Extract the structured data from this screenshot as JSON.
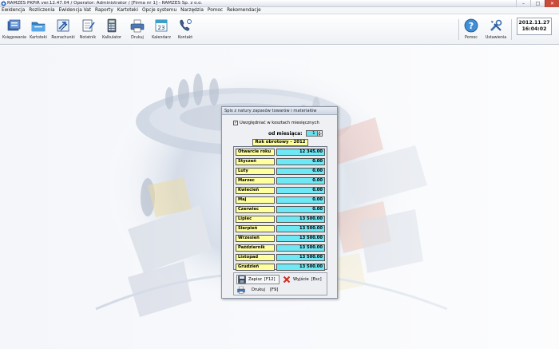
{
  "window": {
    "title": "RAMZES PKPiR  ver.12.47.04 /  Operator: Administrator /  [Firma nr 1] - RAMZES Sp. z o.o."
  },
  "menu": [
    "Ewidencja",
    "Rozliczenia",
    "Ewidencja Vat",
    "Raporty",
    "Kartoteki",
    "Opcje systemu",
    "Narzędzia",
    "Pomoc",
    "Rekomendacje"
  ],
  "toolbar": {
    "buttons": [
      {
        "label": "Księgowanie",
        "icon": "ledger-icon"
      },
      {
        "label": "Kartoteki",
        "icon": "folders-icon"
      },
      {
        "label": "Rozrachunki",
        "icon": "transfer-arrows-icon"
      },
      {
        "label": "Notatnik",
        "icon": "notepad-icon"
      },
      {
        "label": "Kalkulator",
        "icon": "calculator-icon"
      },
      {
        "label": "Drukuj",
        "icon": "printer-icon"
      },
      {
        "label": "Kalendarz",
        "icon": "calendar-icon"
      },
      {
        "label": "Kontakt",
        "icon": "phone-icon"
      }
    ],
    "right_buttons": [
      {
        "label": "Pomoc",
        "icon": "help-icon"
      },
      {
        "label": "Ustawienia",
        "icon": "settings-tools-icon"
      }
    ],
    "calendar_day": "23"
  },
  "datetime": {
    "date": "2012.11.27",
    "time": "16:04:02"
  },
  "dialog": {
    "title": "Spis z natury zapasów towarów i materiałów",
    "checkbox_label": "Uwzględniać w kosztach miesięcznych",
    "checkbox_checked": true,
    "month_label": "od miesiąca:",
    "month_value": "1",
    "year_header": "Rok obrotowy - 2012",
    "rows": [
      {
        "label": "Otwarcie roku",
        "value": "12 345.00"
      },
      {
        "label": "Styczeń",
        "value": "0.00"
      },
      {
        "label": "Luty",
        "value": "0.00"
      },
      {
        "label": "Marzec",
        "value": "0.00"
      },
      {
        "label": "Kwiecień",
        "value": "0.00"
      },
      {
        "label": "Maj",
        "value": "0.00"
      },
      {
        "label": "Czerwiec",
        "value": "0.00"
      },
      {
        "label": "Lipiec",
        "value": "13 500.00"
      },
      {
        "label": "Sierpień",
        "value": "13 500.00"
      },
      {
        "label": "Wrzesień",
        "value": "13 500.00"
      },
      {
        "label": "Październik",
        "value": "13 500.00"
      },
      {
        "label": "Listopad",
        "value": "13 500.00"
      },
      {
        "label": "Grudzień",
        "value": "13 500.00"
      }
    ],
    "save": {
      "label": "Zapisz",
      "key": "[F12]"
    },
    "exit": {
      "label": "Wyjście",
      "key": "[Esc]"
    },
    "print": {
      "label": "Drukuj",
      "key": "[F9]"
    }
  },
  "colors": {
    "month_cell": "#ffff9e",
    "value_cell": "#6ee8f5",
    "accent": "#2a62b8"
  }
}
